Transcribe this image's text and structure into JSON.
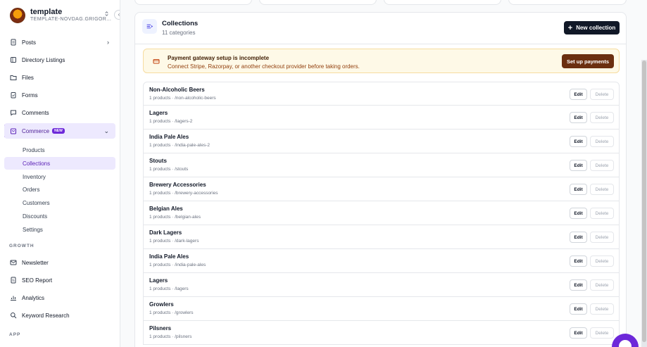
{
  "workspace": {
    "name": "template",
    "subtitle": "TEMPLATE-NOVDAG.GRIGOR..."
  },
  "sidebar": {
    "items": [
      {
        "label": "Posts",
        "icon": "document-icon"
      },
      {
        "label": "Directory Listings",
        "icon": "book-icon"
      },
      {
        "label": "Files",
        "icon": "folder-icon"
      },
      {
        "label": "Forms",
        "icon": "clipboard-icon"
      },
      {
        "label": "Comments",
        "icon": "chat-icon"
      },
      {
        "label": "Commerce",
        "icon": "shop-icon",
        "badge": "NEW"
      }
    ],
    "commerce_items": [
      {
        "label": "Products"
      },
      {
        "label": "Collections"
      },
      {
        "label": "Inventory"
      },
      {
        "label": "Orders"
      },
      {
        "label": "Customers"
      },
      {
        "label": "Discounts"
      },
      {
        "label": "Settings"
      }
    ],
    "growth_label": "GROWTH",
    "growth_items": [
      {
        "label": "Newsletter",
        "icon": "mail-icon"
      },
      {
        "label": "SEO Report",
        "icon": "report-icon"
      },
      {
        "label": "Analytics",
        "icon": "chart-icon"
      },
      {
        "label": "Keyword Research",
        "icon": "search-icon"
      }
    ],
    "app_label": "APP"
  },
  "header": {
    "title": "Collections",
    "subtitle": "11 categories",
    "new_button": "New collection"
  },
  "alert": {
    "title": "Payment gateway setup is incomplete",
    "text": "Connect Stripe, Razorpay, or another checkout provider before taking orders.",
    "button": "Set up payments"
  },
  "row_actions": {
    "edit": "Edit",
    "delete": "Delete"
  },
  "collections": [
    {
      "name": "Non-Alcoholic Beers",
      "meta": "1 products · /non-alcoholic-beers"
    },
    {
      "name": "Lagers",
      "meta": "1 products · /lagers-2"
    },
    {
      "name": "India Pale Ales",
      "meta": "1 products · /india-pale-ales-2"
    },
    {
      "name": "Stouts",
      "meta": "1 products · /stouts"
    },
    {
      "name": "Brewery Accessories",
      "meta": "1 products · /brewery-accessories"
    },
    {
      "name": "Belgian Ales",
      "meta": "1 products · /belgian-ales"
    },
    {
      "name": "Dark Lagers",
      "meta": "1 products · /dark-lagers"
    },
    {
      "name": "India Pale Ales",
      "meta": "1 products · /india-pale-ales"
    },
    {
      "name": "Lagers",
      "meta": "1 products · /lagers"
    },
    {
      "name": "Growlers",
      "meta": "1 products · /growlers"
    },
    {
      "name": "Pilsners",
      "meta": "1 products · /pilsners"
    }
  ],
  "colors": {
    "accent": "#6d28d9",
    "dark_button": "#111827",
    "alert_button": "#6b2f10",
    "alert_bg": "#fef9e7"
  }
}
